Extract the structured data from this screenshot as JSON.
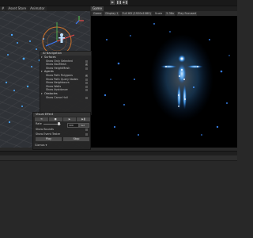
{
  "scene_tabs": [
    "Asset Store",
    "Animator"
  ],
  "game": {
    "tab_label": "Game",
    "toolbar": {
      "mode": "Game",
      "display": "Display 1",
      "resolution": "Full HD (1920x1080)",
      "scale_label": "Scale",
      "scale_value": "5.38x",
      "play_mode": "Play Focused"
    }
  },
  "navigation": {
    "title": "AI Navigation",
    "sections": [
      {
        "label": "Surfaces",
        "items": [
          {
            "label": "Show Only Selected",
            "checked": false
          },
          {
            "label": "Show NavMesh",
            "checked": true
          },
          {
            "label": "Show HeightMesh",
            "checked": false
          }
        ]
      },
      {
        "label": "Agents",
        "items": [
          {
            "label": "Show Path Polygons",
            "checked": true
          },
          {
            "label": "Show Path Query Nodes",
            "checked": false
          },
          {
            "label": "Show Neighbours",
            "checked": false
          },
          {
            "label": "Show Walls",
            "checked": false
          },
          {
            "label": "Show Avoidance",
            "checked": false
          }
        ]
      },
      {
        "label": "Obstacles",
        "items": [
          {
            "label": "Show Carve Hull",
            "checked": false
          }
        ]
      }
    ]
  },
  "visual_effect": {
    "title": "Visual Effect",
    "rate_label": "Rate",
    "rate_value": "100",
    "rate_unit": "Set",
    "show_bounds": "Show Bounds",
    "show_event_tester": "Show Event Tester",
    "play_label": "Play",
    "stop_label": "Stop",
    "gizmos_label": "Gizmos"
  },
  "colors": {
    "accent": "#6fb3ff",
    "particle": "#4aa8ff",
    "gizmo_orange": "#e07a2a"
  }
}
